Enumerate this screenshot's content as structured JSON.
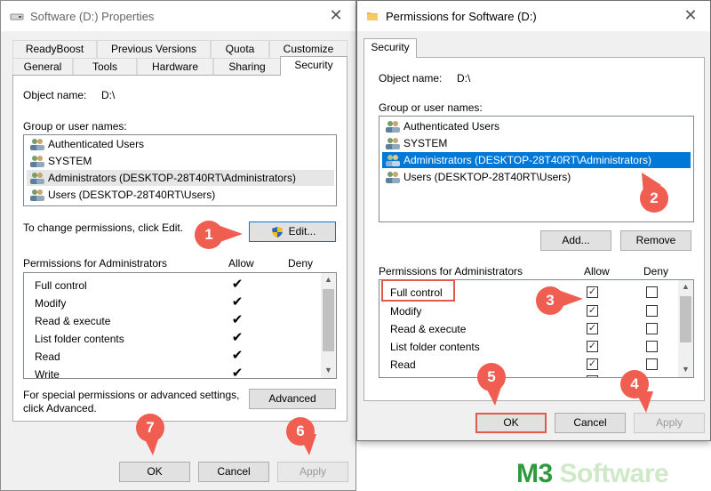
{
  "left_window": {
    "title": "Software (D:) Properties",
    "tabs_row1": [
      "ReadyBoost",
      "Previous Versions",
      "Quota",
      "Customize"
    ],
    "tabs_row2": [
      "General",
      "Tools",
      "Hardware",
      "Sharing",
      "Security"
    ],
    "object_label": "Object name:",
    "object_value": "D:\\",
    "group_label": "Group or user names:",
    "users": [
      "Authenticated Users",
      "SYSTEM",
      "Administrators (DESKTOP-28T40RT\\Administrators)",
      "Users (DESKTOP-28T40RT\\Users)"
    ],
    "change_text": "To change permissions, click Edit.",
    "edit_button": "Edit...",
    "perm_label": "Permissions for Administrators",
    "allow": "Allow",
    "deny": "Deny",
    "permissions": [
      "Full control",
      "Modify",
      "Read & execute",
      "List folder contents",
      "Read",
      "Write"
    ],
    "special_line1": "For special permissions or advanced settings,",
    "special_line2": "click Advanced.",
    "advanced_button": "Advanced",
    "ok": "OK",
    "cancel": "Cancel",
    "apply": "Apply"
  },
  "right_window": {
    "title": "Permissions for Software (D:)",
    "tab": "Security",
    "object_label": "Object name:",
    "object_value": "D:\\",
    "group_label": "Group or user names:",
    "users": [
      "Authenticated Users",
      "SYSTEM",
      "Administrators (DESKTOP-28T40RT\\Administrators)",
      "Users (DESKTOP-28T40RT\\Users)"
    ],
    "add_button": "Add...",
    "remove_button": "Remove",
    "perm_label": "Permissions for Administrators",
    "allow": "Allow",
    "deny": "Deny",
    "permissions": [
      "Full control",
      "Modify",
      "Read & execute",
      "List folder contents",
      "Read"
    ],
    "ok": "OK",
    "cancel": "Cancel",
    "apply": "Apply"
  },
  "badges": [
    "1",
    "2",
    "3",
    "4",
    "5",
    "6",
    "7"
  ],
  "watermark": {
    "m3": "M3",
    "software": "Software"
  },
  "colors": {
    "badge": "#ef5e50",
    "selection": "#0078d7",
    "watermark": "#2e9a3e"
  }
}
